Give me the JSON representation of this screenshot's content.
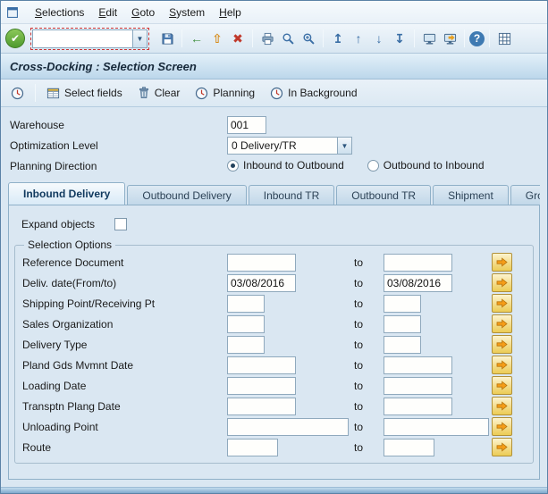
{
  "title": "Cross-Docking : Selection Screen",
  "icons": {
    "enter": "✔",
    "dropdown_arrow": "▼"
  },
  "colors": {
    "accent_blue": "#3a6ea5",
    "content_bg": "#dae7f2",
    "multi_select_yellow": "#f3dc8a",
    "arrow_orange": "#f59d18",
    "cancel_red": "#c0392b",
    "enter_green": "#4e9a2e",
    "exit_orange": "#d78d1e"
  },
  "menubar": {
    "items": [
      {
        "id": "selections",
        "label": "Selections"
      },
      {
        "id": "edit",
        "label": "Edit"
      },
      {
        "id": "goto",
        "label": "Goto"
      },
      {
        "id": "system",
        "label": "System"
      },
      {
        "id": "help",
        "label": "Help"
      }
    ]
  },
  "toolbar": {
    "command_field": {
      "value": ""
    },
    "icons": [
      {
        "name": "save-icon",
        "type": "floppy"
      },
      {
        "type": "sep"
      },
      {
        "name": "back-icon",
        "type": "glyph",
        "glyph": "←",
        "color": "#3e8e3e"
      },
      {
        "name": "exit-icon",
        "type": "glyph",
        "glyph": "⇧",
        "color": "#d78d1e"
      },
      {
        "name": "cancel-icon",
        "type": "glyph",
        "glyph": "✖",
        "color": "#c0392b"
      },
      {
        "type": "sep"
      },
      {
        "name": "print-icon",
        "type": "print"
      },
      {
        "name": "find-icon",
        "type": "find"
      },
      {
        "name": "find-next-icon",
        "type": "findnext"
      },
      {
        "type": "sep"
      },
      {
        "name": "first-page-icon",
        "type": "glyph",
        "glyph": "↥",
        "color": "#3a6ea5"
      },
      {
        "name": "previous-page-icon",
        "type": "glyph",
        "glyph": "↑",
        "color": "#3a6ea5"
      },
      {
        "name": "next-page-icon",
        "type": "glyph",
        "glyph": "↓",
        "color": "#3a6ea5"
      },
      {
        "name": "last-page-icon",
        "type": "glyph",
        "glyph": "↧",
        "color": "#3a6ea5"
      },
      {
        "type": "sep"
      },
      {
        "name": "new-session-icon",
        "type": "monitor"
      },
      {
        "name": "create-shortcut-icon",
        "type": "monitorArrow"
      },
      {
        "type": "sep"
      },
      {
        "name": "help-icon",
        "type": "help",
        "glyph": "?"
      },
      {
        "type": "sep"
      },
      {
        "name": "customize-layout-icon",
        "type": "grid"
      }
    ]
  },
  "app_toolbar": {
    "items": [
      {
        "name": "execute-button",
        "icon": "clock",
        "icon_name": "execute-clock-icon",
        "label": ""
      },
      {
        "type": "sep"
      },
      {
        "name": "select-fields-button",
        "icon": "fields",
        "icon_name": "select-fields-icon",
        "label": "Select fields"
      },
      {
        "name": "clear-button",
        "icon": "trash",
        "icon_name": "trash-icon",
        "label": "Clear"
      },
      {
        "name": "planning-button",
        "icon": "clock",
        "icon_name": "planning-clock-icon",
        "label": "Planning"
      },
      {
        "name": "in-background-button",
        "icon": "clock",
        "icon_name": "in-background-clock-icon",
        "label": "In Background"
      }
    ]
  },
  "header_fields": {
    "warehouse": {
      "label": "Warehouse",
      "value": "001"
    },
    "optimization": {
      "label": "Optimization Level",
      "value": "0 Delivery/TR"
    },
    "planning_direction": {
      "label": "Planning Direction",
      "options": [
        {
          "label": "Inbound to Outbound",
          "selected": true
        },
        {
          "label": "Outbound to Inbound",
          "selected": false
        }
      ]
    }
  },
  "tabs": {
    "active": 0,
    "items": [
      "Inbound Delivery",
      "Outbound Delivery",
      "Inbound TR",
      "Outbound TR",
      "Shipment",
      "Group"
    ]
  },
  "tab_panel": {
    "expand_objects_label": "Expand objects",
    "expand_objects_checked": false,
    "group_title": "Selection Options",
    "to_label": "to",
    "rows": [
      {
        "label": "Reference Document",
        "from_value": "",
        "to_value": "",
        "from_size": "md",
        "to_size": "md"
      },
      {
        "label": "Deliv. date(From/to)",
        "from_value": "03/08/2016",
        "to_value": "03/08/2016",
        "from_size": "md",
        "to_size": "md"
      },
      {
        "label": "Shipping Point/Receiving Pt",
        "from_value": "",
        "to_value": "",
        "from_size": "sm",
        "to_size": "sm"
      },
      {
        "label": "Sales Organization",
        "from_value": "",
        "to_value": "",
        "from_size": "sm",
        "to_size": "sm"
      },
      {
        "label": "Delivery Type",
        "from_value": "",
        "to_value": "",
        "from_size": "sm",
        "to_size": "sm"
      },
      {
        "label": "Pland Gds Mvmnt Date",
        "from_value": "",
        "to_value": "",
        "from_size": "md",
        "to_size": "md"
      },
      {
        "label": "Loading Date",
        "from_value": "",
        "to_value": "",
        "from_size": "md",
        "to_size": "md"
      },
      {
        "label": "Transptn Plang Date",
        "from_value": "",
        "to_value": "",
        "from_size": "md",
        "to_size": "md"
      },
      {
        "label": "Unloading Point",
        "from_value": "",
        "to_value": "",
        "from_size": "lg",
        "to_size": "xl"
      },
      {
        "label": "Route",
        "from_value": "",
        "to_value": "",
        "from_size": "rt",
        "to_size": "rt"
      }
    ]
  }
}
